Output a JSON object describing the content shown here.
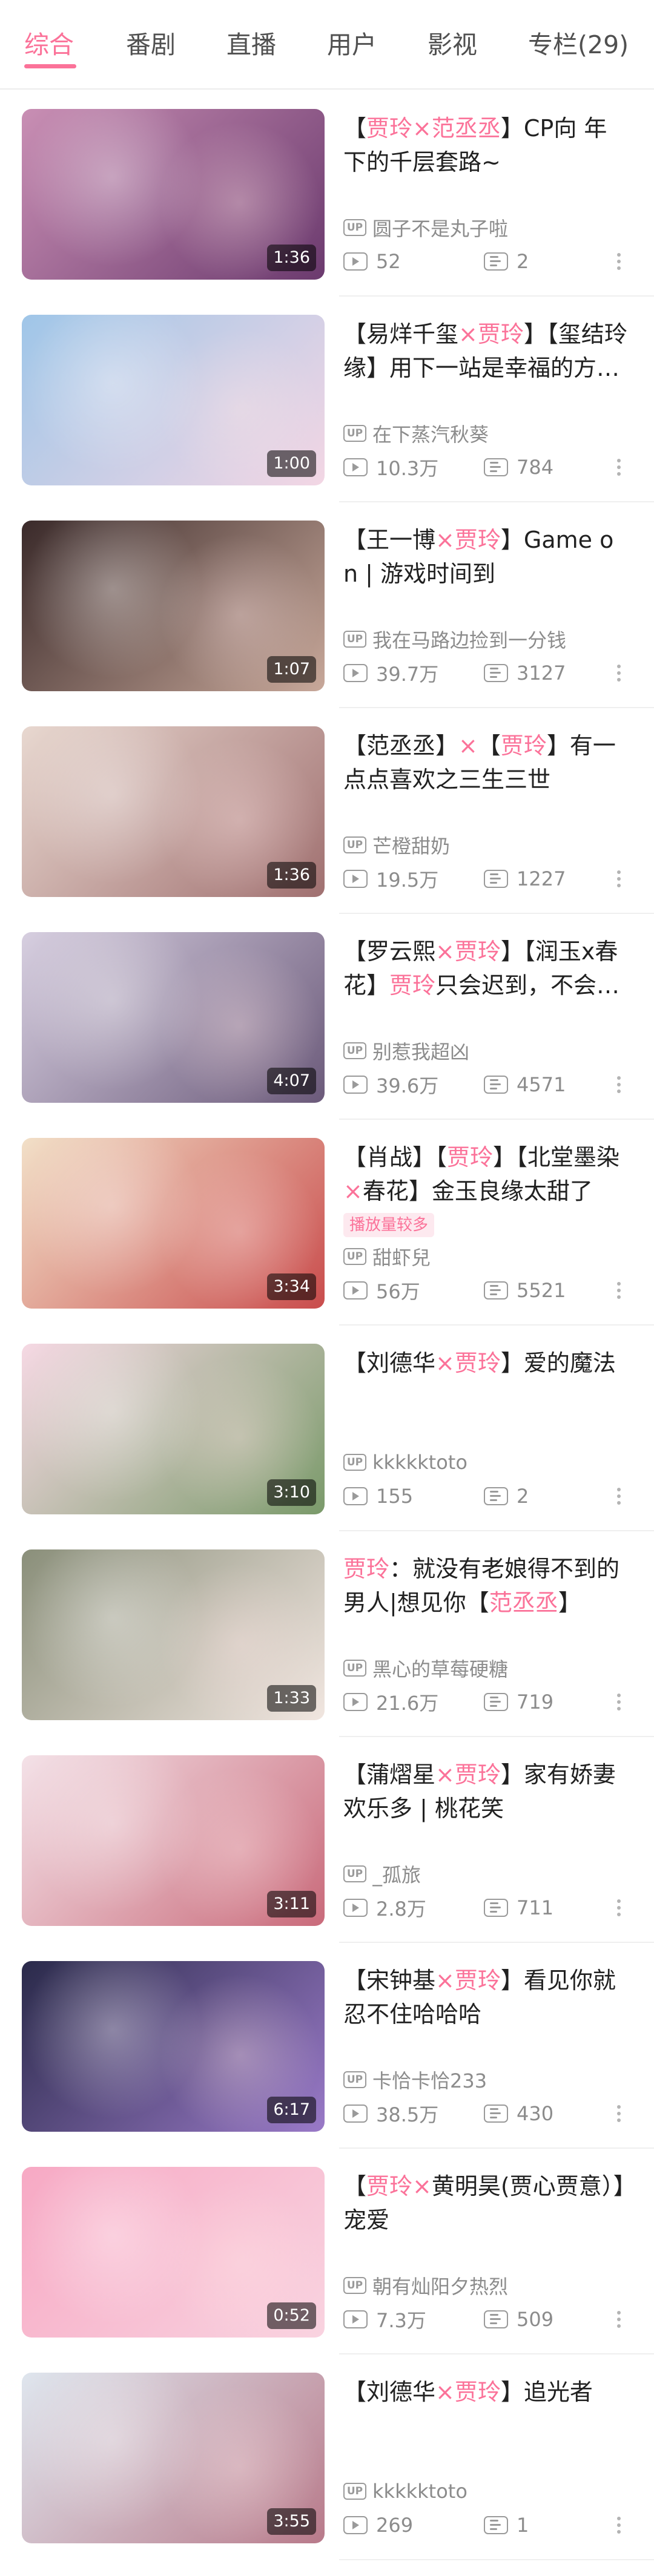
{
  "tabs": [
    {
      "label": "综合",
      "active": true
    },
    {
      "label": "番剧",
      "active": false
    },
    {
      "label": "直播",
      "active": false
    },
    {
      "label": "用户",
      "active": false
    },
    {
      "label": "影视",
      "active": false
    },
    {
      "label": "专栏(29)",
      "active": false
    }
  ],
  "colors": {
    "accent": "#fb7299",
    "text": "#212121",
    "meta": "#8c8c8c"
  },
  "icons": {
    "uploader": "up-icon",
    "plays": "play-icon",
    "danmaku": "danmaku-icon",
    "more": "more-vertical-icon"
  },
  "up_label": "UP",
  "videos": [
    {
      "title_parts": [
        [
          "【",
          0
        ],
        [
          "贾玲",
          1
        ],
        [
          "×",
          1
        ],
        [
          "范丞丞",
          1
        ],
        [
          "】CP向 年下的千层套路~",
          0
        ]
      ],
      "badge": "",
      "uploader": "圆子不是丸子啦",
      "plays": "52",
      "danmaku": "2",
      "duration": "1:36"
    },
    {
      "title_parts": [
        [
          "【易烊千玺",
          0
        ],
        [
          "×",
          1
        ],
        [
          "贾玲",
          1
        ],
        [
          "】【玺结玲缘】用下一站是幸福的方式打开",
          0
        ]
      ],
      "badge": "",
      "uploader": "在下蒸汽秋葵",
      "plays": "10.3万",
      "danmaku": "784",
      "duration": "1:00"
    },
    {
      "title_parts": [
        [
          "【王一博",
          0
        ],
        [
          "×",
          1
        ],
        [
          "贾玲",
          1
        ],
        [
          "】Game on | 游戏时间到",
          0
        ]
      ],
      "badge": "",
      "uploader": "我在马路边捡到一分钱",
      "plays": "39.7万",
      "danmaku": "3127",
      "duration": "1:07"
    },
    {
      "title_parts": [
        [
          "【范丞丞】",
          0
        ],
        [
          "×",
          1
        ],
        [
          "【",
          0
        ],
        [
          "贾玲",
          1
        ],
        [
          "】有一点点喜欢之三生三世",
          0
        ]
      ],
      "badge": "",
      "uploader": "芒橙甜奶",
      "plays": "19.5万",
      "danmaku": "1227",
      "duration": "1:36"
    },
    {
      "title_parts": [
        [
          "【罗云熙",
          0
        ],
        [
          "×",
          1
        ],
        [
          "贾玲",
          1
        ],
        [
          "】【润玉x春花】",
          0
        ],
        [
          "贾玲",
          1
        ],
        [
          "只会迟到，不会缺席",
          0
        ]
      ],
      "badge": "",
      "uploader": "别惹我超凶",
      "plays": "39.6万",
      "danmaku": "4571",
      "duration": "4:07"
    },
    {
      "title_parts": [
        [
          "【肖战】【",
          0
        ],
        [
          "贾玲",
          1
        ],
        [
          "】【北堂墨染",
          0
        ],
        [
          "×",
          1
        ],
        [
          "春花】金玉良缘太甜了",
          0
        ]
      ],
      "badge": "播放量较多",
      "uploader": "甜虾兒",
      "plays": "56万",
      "danmaku": "5521",
      "duration": "3:34"
    },
    {
      "title_parts": [
        [
          "【刘德华",
          0
        ],
        [
          "×",
          1
        ],
        [
          "贾玲",
          1
        ],
        [
          "】爱的魔法",
          0
        ]
      ],
      "badge": "",
      "uploader": "kkkkktoto",
      "plays": "155",
      "danmaku": "2",
      "duration": "3:10"
    },
    {
      "title_parts": [
        [
          "贾玲",
          1
        ],
        [
          "：就没有老娘得不到的男人|想见你【",
          0
        ],
        [
          "范丞丞",
          1
        ],
        [
          "】",
          0
        ]
      ],
      "badge": "",
      "uploader": "黑心的草莓硬糖",
      "plays": "21.6万",
      "danmaku": "719",
      "duration": "1:33"
    },
    {
      "title_parts": [
        [
          "【蒲熠星",
          0
        ],
        [
          "×",
          1
        ],
        [
          "贾玲",
          1
        ],
        [
          "】家有娇妻欢乐多 | 桃花笑",
          0
        ]
      ],
      "badge": "",
      "uploader": "_孤旅",
      "plays": "2.8万",
      "danmaku": "711",
      "duration": "3:11"
    },
    {
      "title_parts": [
        [
          "【宋钟基",
          0
        ],
        [
          "×",
          1
        ],
        [
          "贾玲",
          1
        ],
        [
          "】看见你就忍不住哈哈哈",
          0
        ]
      ],
      "badge": "",
      "uploader": "卡恰卡恰233",
      "plays": "38.5万",
      "danmaku": "430",
      "duration": "6:17"
    },
    {
      "title_parts": [
        [
          "【",
          0
        ],
        [
          "贾玲",
          1
        ],
        [
          "×",
          1
        ],
        [
          "黄明昊(贾心贾意）】宠爱",
          0
        ]
      ],
      "badge": "",
      "uploader": "朝有灿阳夕热烈",
      "plays": "7.3万",
      "danmaku": "509",
      "duration": "0:52"
    },
    {
      "title_parts": [
        [
          "【刘德华",
          0
        ],
        [
          "×",
          1
        ],
        [
          "贾玲",
          1
        ],
        [
          "】追光者",
          0
        ]
      ],
      "badge": "",
      "uploader": "kkkkktoto",
      "plays": "269",
      "danmaku": "1",
      "duration": "3:55"
    }
  ]
}
